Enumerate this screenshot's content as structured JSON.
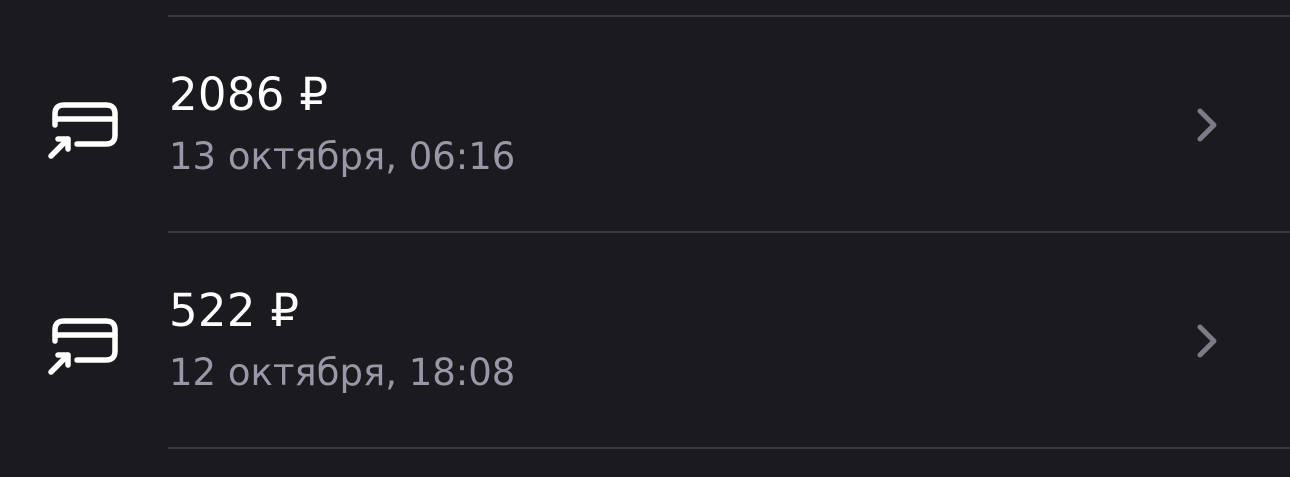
{
  "colors": {
    "background": "#1b1a1f",
    "divider": "#3a3940",
    "amount_text": "#ffffff",
    "date_text": "#9a98a8",
    "chevron": "#7c7b86"
  },
  "transactions": [
    {
      "icon": "card-incoming-icon",
      "amount": "2086 ₽",
      "date": "13 октября, 06:16"
    },
    {
      "icon": "card-incoming-icon",
      "amount": "522 ₽",
      "date": "12 октября, 18:08"
    }
  ]
}
